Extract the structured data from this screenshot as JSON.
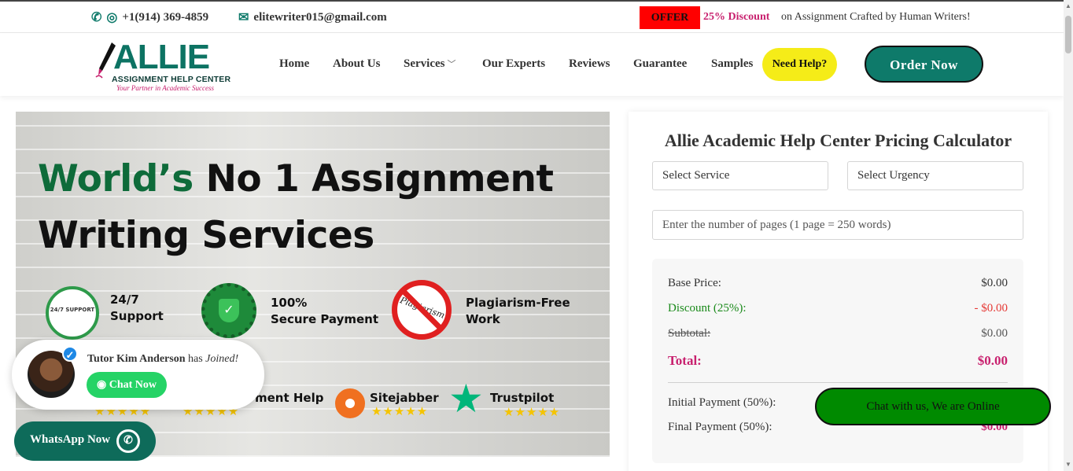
{
  "topbar": {
    "phone": "+1(914) 369-4859",
    "email": "elitewriter015@gmail.com",
    "offer_badge": "OFFER",
    "offer_discount": "25% Discount",
    "offer_text": "on Assignment Crafted by Human Writers!"
  },
  "logo": {
    "title": "ALLIE",
    "subtitle": "ASSIGNMENT HELP CENTER",
    "tagline": "Your Partner in Academic Success"
  },
  "nav": {
    "items": [
      "Home",
      "About Us",
      "Services",
      "Our Experts",
      "Reviews",
      "Guarantee",
      "Samples"
    ],
    "need_help": "Need Help?",
    "order_now": "Order Now"
  },
  "hero": {
    "headline_green": "World’s",
    "headline_rest": " No 1 Assignment",
    "headline_line2": "Writing Services",
    "features": [
      {
        "icon_text": "24/7 SUPPORT",
        "label": "24/7\nSupport"
      },
      {
        "label": "100%\nSecure Payment"
      },
      {
        "icon_text": "Plagiarism",
        "label": "Plagiarism-Free\nWork"
      }
    ],
    "ratings": [
      {
        "label": "ment Help"
      },
      {
        "label": "Sitejabber"
      },
      {
        "label": "Trustpilot"
      }
    ],
    "stars": "★★★★★"
  },
  "tutor_popup": {
    "name": "Tutor Kim Anderson",
    "has": "has",
    "joined": "Joined!",
    "chat_now": "Chat Now"
  },
  "whatsapp": {
    "label": "WhatsApp Now"
  },
  "calculator": {
    "title": "Allie Academic Help Center Pricing Calculator",
    "select_service": "Select Service",
    "select_urgency": "Select Urgency",
    "pages_placeholder": "Enter the number of pages (1 page = 250 words)",
    "base_price_label": "Base Price:",
    "base_price_value": "$0.00",
    "discount_label": "Discount (25%):",
    "discount_value": "- $0.00",
    "subtotal_label": "Subtotal:",
    "subtotal_value": "$0.00",
    "total_label": "Total:",
    "total_value": "$0.00",
    "initial_label": "Initial Payment (50%):",
    "final_label": "Final Payment (50%):",
    "final_value": "$0.00"
  },
  "chat_online": "Chat with us, We are Online",
  "colors": {
    "brand_teal": "#0e7a6a",
    "accent_pink": "#c8206e",
    "need_help_yellow": "#f5ec18",
    "offer_red": "#ff0000",
    "chat_green": "#008a00"
  }
}
